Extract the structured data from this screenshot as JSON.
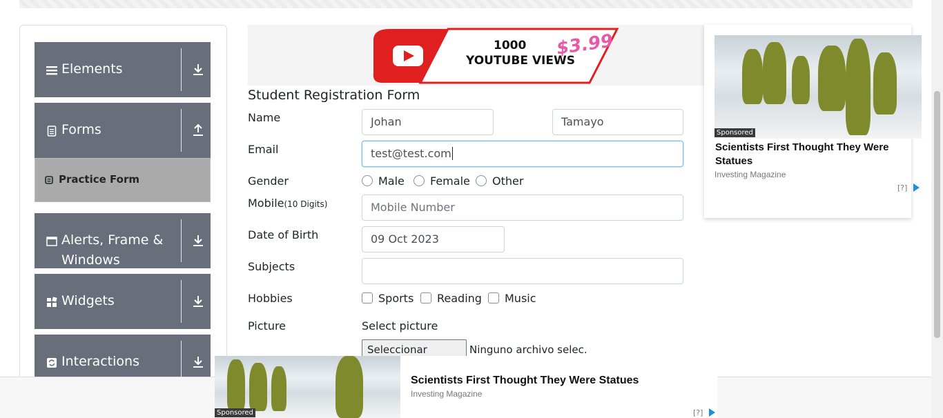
{
  "sidebar": {
    "groups": [
      {
        "label": "Elements",
        "icon": "hamburger-icon",
        "arrow": "download-arrow-icon"
      },
      {
        "label": "Forms",
        "icon": "document-icon",
        "arrow": "upload-arrow-icon"
      },
      {
        "label": "Alerts, Frame &",
        "label2": "Windows",
        "icon": "window-icon",
        "arrow": "download-arrow-icon"
      },
      {
        "label": "Widgets",
        "icon": "widgets-icon",
        "arrow": "download-arrow-icon"
      },
      {
        "label": "Interactions",
        "icon": "interactions-icon",
        "arrow": "download-arrow-icon"
      }
    ],
    "active_item": "Practice Form"
  },
  "banner": {
    "line1": "1000",
    "line2": "YOUTUBE VIEWS",
    "price": "$3.99"
  },
  "form": {
    "title": "Student Registration Form",
    "name_label": "Name",
    "first_name": "Johan",
    "last_name": "Tamayo",
    "email_label": "Email",
    "email": "test@test.com",
    "gender_label": "Gender",
    "gender_options": [
      "Male",
      "Female",
      "Other"
    ],
    "mobile_label": "Mobile",
    "mobile_hint": "(10 Digits)",
    "mobile_placeholder": "Mobile Number",
    "dob_label": "Date of Birth",
    "dob": "09 Oct 2023",
    "subjects_label": "Subjects",
    "hobbies_label": "Hobbies",
    "hobbies": [
      "Sports",
      "Reading",
      "Music"
    ],
    "picture_label": "Picture",
    "select_picture": "Select picture",
    "file_button": "Seleccionar archivo",
    "file_status": "Ninguno archivo selec."
  },
  "ad_right": {
    "badge": "Sponsored",
    "headline": "Scientists First Thought They Were Statues",
    "source": "Investing Magazine",
    "info": "[?]"
  },
  "ad_bottom": {
    "badge": "Sponsored",
    "headline": "Scientists First Thought They Were Statues",
    "source": "Investing Magazine",
    "info": "[?]"
  },
  "colors": {
    "sidebar_group": "#686f7a",
    "active_item": "#aaaaaa",
    "focus_border": "#80bdff"
  }
}
